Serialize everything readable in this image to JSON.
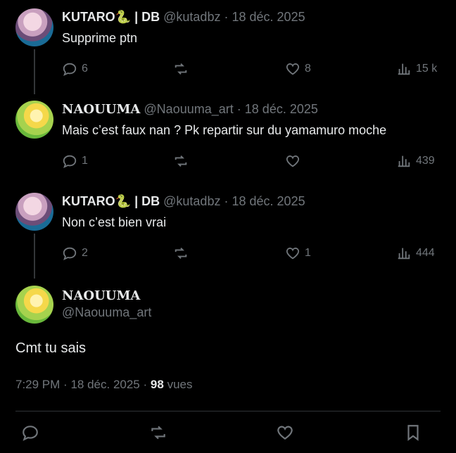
{
  "tweets": [
    {
      "name": "KUTARO",
      "emoji": "🐍",
      "suffix": " | DB",
      "handle": "@kutadbz",
      "date": "18 déc. 2025",
      "text": "Supprime ptn",
      "replies": "6",
      "retweets": "",
      "likes": "8",
      "views": "15 k"
    },
    {
      "name": "NAOUUMA",
      "handle": "@Naouuma_art",
      "date": "18 déc. 2025",
      "text": "Mais c’est faux nan ? Pk repartir sur du yamamuro moche",
      "replies": "1",
      "retweets": "",
      "likes": "",
      "views": "439"
    },
    {
      "name": "KUTARO",
      "emoji": "🐍",
      "suffix": " | DB",
      "handle": "@kutadbz",
      "date": "18 déc. 2025",
      "text": "Non c’est bien vrai",
      "replies": "2",
      "retweets": "",
      "likes": "1",
      "views": "444"
    }
  ],
  "main_tweet": {
    "name": "NAOUUMA",
    "handle": "@Naouuma_art",
    "text": "Cmt tu sais",
    "time": "7:29 PM",
    "date": "18 déc. 2025",
    "views_count": "98",
    "views_label": "vues"
  },
  "separator": "·",
  "icons": {
    "reply": "reply-icon",
    "retweet": "retweet-icon",
    "like": "heart-icon",
    "views": "views-icon",
    "bookmark": "bookmark-icon"
  }
}
